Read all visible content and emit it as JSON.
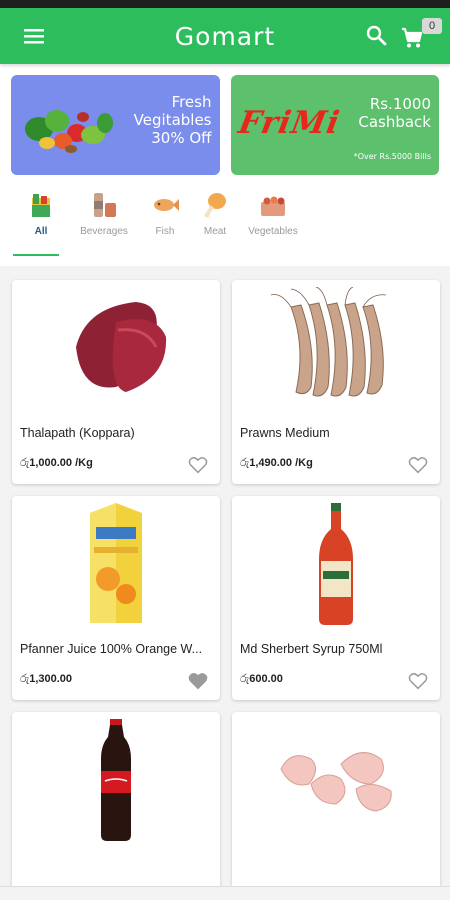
{
  "app": {
    "title": "Gomart",
    "cart_count": "0"
  },
  "banners": [
    {
      "line1": "Fresh",
      "line2": "Vegitables",
      "line3": "30% Off"
    },
    {
      "brand": "FriMi",
      "line1": "Rs.1000",
      "line2": "Cashback",
      "note": "*Over Rs.5000 Bills"
    }
  ],
  "categories": [
    {
      "label": "All",
      "icon": "grocery-bag-icon",
      "active": true
    },
    {
      "label": "Beverages",
      "icon": "bottles-icon"
    },
    {
      "label": "Fish",
      "icon": "fish-icon"
    },
    {
      "label": "Meat",
      "icon": "drumstick-icon"
    },
    {
      "label": "Vegetables",
      "icon": "veg-basket-icon"
    }
  ],
  "products": [
    {
      "name": "Thalapath (Koppara)",
      "currency": "රු",
      "price": "1,000.00 /Kg",
      "favorite": false,
      "image": "tuna-steak"
    },
    {
      "name": "Prawns Medium",
      "currency": "රු",
      "price": "1,490.00 /Kg",
      "favorite": false,
      "image": "prawns"
    },
    {
      "name": "Pfanner Juice 100% Orange W...",
      "currency": "රු",
      "price": "1,300.00",
      "favorite": true,
      "image": "juice-carton"
    },
    {
      "name": "Md Sherbert Syrup 750Ml",
      "currency": "රු",
      "price": "600.00",
      "favorite": false,
      "image": "syrup-bottle"
    },
    {
      "name": "",
      "currency": "",
      "price": "",
      "favorite": false,
      "image": "coca-cola-bottle"
    },
    {
      "name": "",
      "currency": "",
      "price": "",
      "favorite": false,
      "image": "chicken-wings"
    }
  ],
  "colors": {
    "primary": "#2ebd5c",
    "banner1": "#7a8cec",
    "banner2": "#5cc06c",
    "frimi": "#e8271c"
  }
}
